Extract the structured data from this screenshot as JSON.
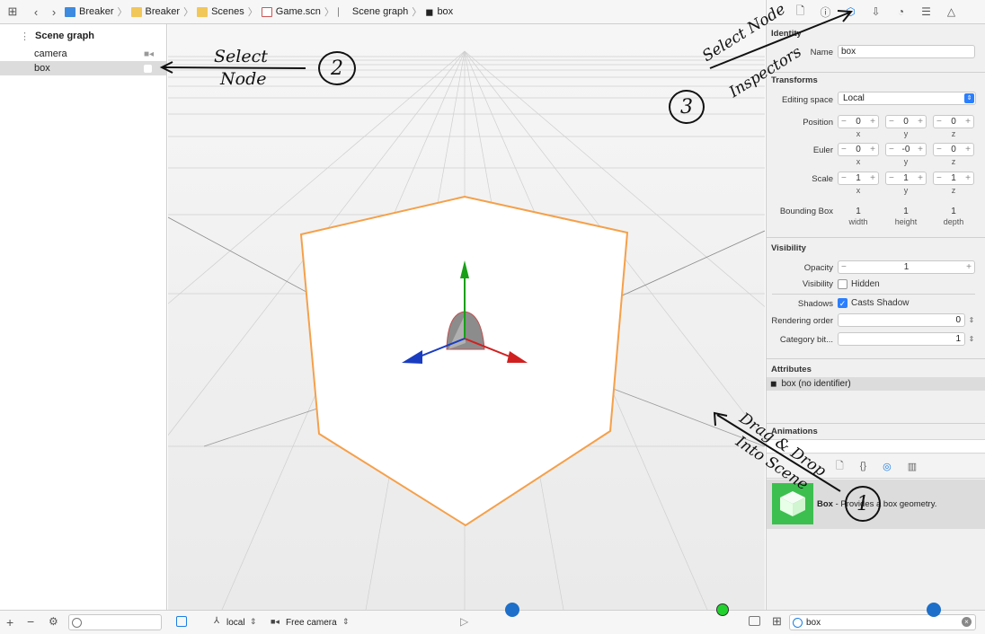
{
  "breadcrumb": [
    "Breaker",
    "Breaker",
    "Scenes",
    "Game.scn",
    "Scene graph",
    "box"
  ],
  "outline": {
    "header": "Scene graph",
    "items": [
      {
        "label": "camera"
      },
      {
        "label": "box"
      }
    ]
  },
  "inspector": {
    "identity": {
      "title": "Identity",
      "name_label": "Name",
      "name_value": "box"
    },
    "transforms": {
      "title": "Transforms",
      "editing_space_label": "Editing space",
      "editing_space_value": "Local",
      "position_label": "Position",
      "position": {
        "x": "0",
        "y": "0",
        "z": "0"
      },
      "euler_label": "Euler",
      "euler": {
        "x": "0",
        "y": "-0",
        "z": "0"
      },
      "scale_label": "Scale",
      "scale": {
        "x": "1",
        "y": "1",
        "z": "1"
      },
      "axis_x": "x",
      "axis_y": "y",
      "axis_z": "z",
      "bbox_label": "Bounding Box",
      "bbox": {
        "width": "1",
        "height": "1",
        "depth": "1"
      },
      "bbox_width_label": "width",
      "bbox_height_label": "height",
      "bbox_depth_label": "depth"
    },
    "visibility": {
      "title": "Visibility",
      "opacity_label": "Opacity",
      "opacity_value": "1",
      "visibility_label": "Visibility",
      "hidden_label": "Hidden",
      "shadows_label": "Shadows",
      "casts_shadow_label": "Casts Shadow",
      "rendering_order_label": "Rendering order",
      "rendering_order_value": "0",
      "category_label": "Category bit...",
      "category_value": "1"
    },
    "attributes": {
      "title": "Attributes",
      "item": "box (no identifier)"
    },
    "animations": {
      "title": "Animations"
    },
    "library": {
      "box_title": "Box",
      "box_desc": " - Provides a box geometry."
    }
  },
  "bottombar": {
    "space_value": "local",
    "camera_value": "Free camera",
    "library_search_value": "box"
  },
  "annotations": {
    "select_node_1": "Select",
    "select_node_2": "Node",
    "num_2": "2",
    "inspectors_1": "Select Node",
    "inspectors_2": "Inspectors",
    "num_3": "3",
    "drag_1": "Drag & Drop",
    "drag_2": "Into Scene",
    "num_1": "1"
  },
  "colors": {
    "accent": "#1b7ee6",
    "selection_outline": "#f5a04a",
    "axis_x": "#d02020",
    "axis_y": "#18a018",
    "axis_z": "#1a3cc0",
    "library_icon": "#3cbf4f"
  }
}
